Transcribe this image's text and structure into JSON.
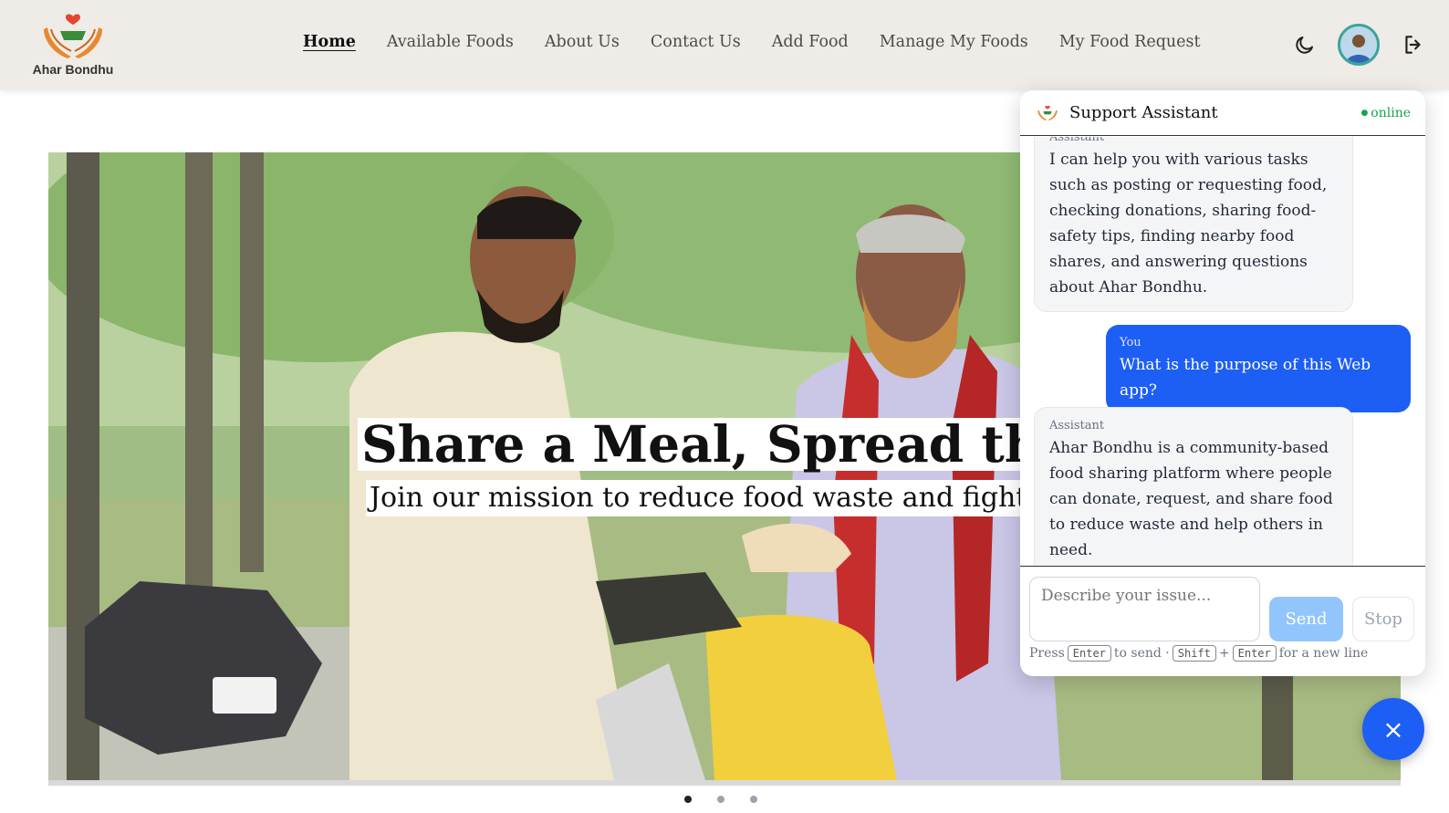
{
  "brand": {
    "name": "Ahar Bondhu",
    "logo_icon": "hands-heart-bowl-logo"
  },
  "nav": {
    "links": [
      {
        "label": "Home",
        "active": true
      },
      {
        "label": "Available Foods"
      },
      {
        "label": "About Us"
      },
      {
        "label": "Contact Us"
      },
      {
        "label": "Add Food"
      },
      {
        "label": "Manage My Foods"
      },
      {
        "label": "My Food Request"
      }
    ],
    "icons": [
      "moon-icon",
      "avatar",
      "logout-icon"
    ]
  },
  "hero": {
    "title": "Share a Meal, Spread the Joy",
    "subtitle": "Join our mission to reduce food waste and fight hunger",
    "slides_total": 3,
    "active_slide": 1
  },
  "chat": {
    "title": "Support Assistant",
    "status": "online",
    "messages": [
      {
        "role": "assistant",
        "who": "Assistant",
        "text": "I can help you with various tasks such as posting or requesting food, checking donations, sharing food-safety tips, finding nearby food shares, and answering questions about Ahar Bondhu."
      },
      {
        "role": "user",
        "who": "You",
        "text": "What is the purpose of this Web app?"
      },
      {
        "role": "assistant",
        "who": "Assistant",
        "text": "Ahar Bondhu is a community-based food sharing platform where people can donate, request, and share food to reduce waste and help others in need."
      }
    ],
    "input_placeholder": "Describe your issue...",
    "send_label": "Send",
    "stop_label": "Stop",
    "hint": {
      "press": "Press",
      "key_enter": "Enter",
      "to_send": "to send ·",
      "key_shift": "Shift",
      "plus": "+",
      "for_new_line": "for a new line"
    },
    "close_symbol": "×"
  },
  "colors": {
    "navbar_bg": "#efebe7",
    "accent_blue": "#1d5ef5",
    "send_disabled": "#93c5fd",
    "online_green": "#16a34a"
  }
}
